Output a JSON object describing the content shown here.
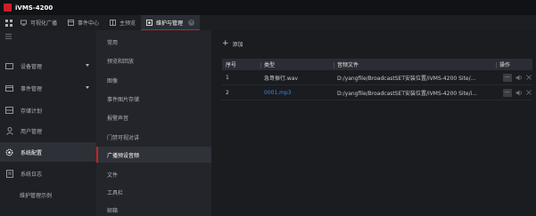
{
  "app": {
    "title": "iVMS-4200"
  },
  "topbar": {
    "tabs": [
      {
        "label": "可视化广播",
        "icon": "broadcast-icon"
      },
      {
        "label": "事件中心",
        "icon": "event-icon"
      },
      {
        "label": "主预览",
        "icon": "preview-icon"
      },
      {
        "label": "维护与管理",
        "icon": "maintenance-icon",
        "active": true
      }
    ]
  },
  "sidebar": {
    "items": [
      {
        "label": "设备管理",
        "icon": "device-icon",
        "has_arrow": true
      },
      {
        "label": "事件管理",
        "icon": "event-manage-icon",
        "has_arrow": true
      },
      {
        "label": "存储计划",
        "icon": "storage-icon"
      },
      {
        "label": "用户管理",
        "icon": "user-icon"
      },
      {
        "label": "系统配置",
        "icon": "settings-icon",
        "active": true
      },
      {
        "label": "系统日志",
        "icon": "log-icon"
      },
      {
        "label": "维护管理示例"
      }
    ]
  },
  "submenu": {
    "items": [
      {
        "label": "常用"
      },
      {
        "label": "预览和回放"
      },
      {
        "label": "图像"
      },
      {
        "label": "事件图片存储"
      },
      {
        "label": "报警声音"
      },
      {
        "label": "门禁可视对讲"
      },
      {
        "label": "广播预设音频",
        "active": true
      },
      {
        "label": "文件"
      },
      {
        "label": "工具栏"
      },
      {
        "label": "邮箱"
      }
    ]
  },
  "main": {
    "add_label": "添加",
    "table": {
      "headers": {
        "index": "序号",
        "type": "类型",
        "file": "音频文件",
        "ops": "操作"
      },
      "rows": [
        {
          "index": "1",
          "type": "急哥振行.wav",
          "file": "D:/yangfile/BroadcastSET安装位置/iVMS-4200 Site/..."
        },
        {
          "index": "2",
          "type": "0001.mp3",
          "file": "D:/yangfile/BroadcastSET安装位置/iVMS-4200 Site/i..."
        }
      ],
      "dots_label": "···"
    }
  },
  "colors": {
    "accent": "#c8202a",
    "link": "#3a86e8",
    "background": "#17191e"
  }
}
